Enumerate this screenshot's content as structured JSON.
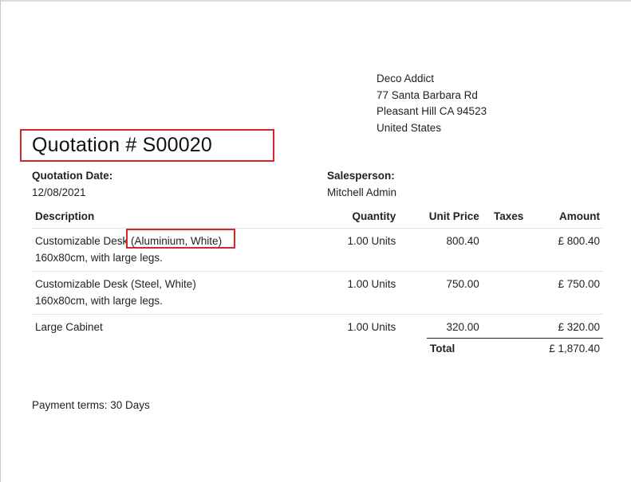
{
  "customer": {
    "name": "Deco Addict",
    "street": "77 Santa Barbara Rd",
    "city_line": "Pleasant Hill CA 94523",
    "country": "United States"
  },
  "quotation": {
    "title": "Quotation # S00020"
  },
  "info": {
    "date_label": "Quotation Date:",
    "date_value": "12/08/2021",
    "salesperson_label": "Salesperson:",
    "salesperson_value": "Mitchell Admin"
  },
  "table": {
    "headers": {
      "description": "Description",
      "quantity": "Quantity",
      "unit_price": "Unit Price",
      "taxes": "Taxes",
      "amount": "Amount"
    },
    "rows": [
      {
        "description_line1": "Customizable Desk (Aluminium, White)",
        "description_line2": "160x80cm, with large legs.",
        "quantity": "1.00 Units",
        "unit_price": "800.40",
        "taxes": "",
        "amount": "£ 800.40"
      },
      {
        "description_line1": "Customizable Desk (Steel, White)",
        "description_line2": "160x80cm, with large legs.",
        "quantity": "1.00 Units",
        "unit_price": "750.00",
        "taxes": "",
        "amount": "£ 750.00"
      },
      {
        "description_line1": "Large Cabinet",
        "description_line2": "",
        "quantity": "1.00 Units",
        "unit_price": "320.00",
        "taxes": "",
        "amount": "£ 320.00"
      }
    ]
  },
  "totals": {
    "total_label": "Total",
    "total_value": "£ 1,870.40"
  },
  "payment_terms": "Payment terms: 30 Days",
  "colors": {
    "highlight": "#d9262b"
  }
}
